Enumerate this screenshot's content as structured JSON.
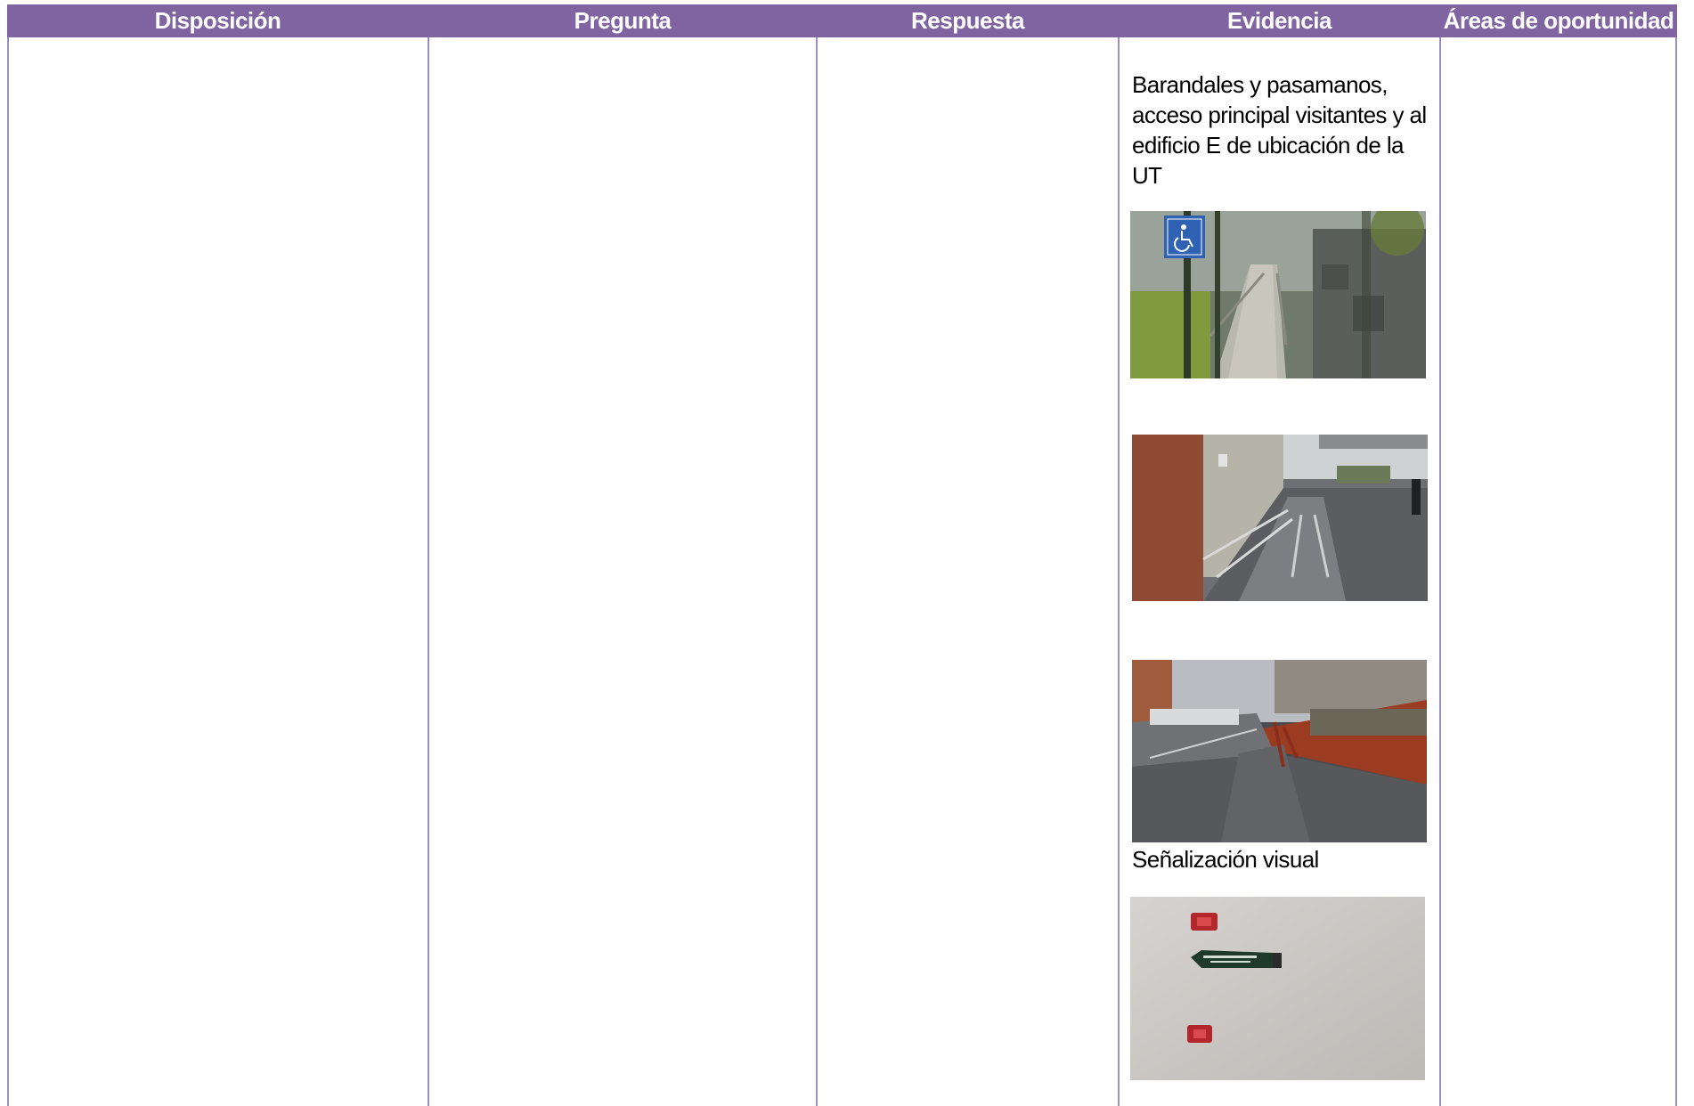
{
  "table": {
    "headers": [
      "Disposición",
      "Pregunta",
      "Respuesta",
      "Evidencia",
      "Áreas de oportunidad"
    ],
    "header_color": "#8064a2",
    "border_color": "#9b8fc4"
  },
  "evidence": {
    "text_1": "Barandales y pasamanos, acceso principal visitantes y al edificio E de ubicación de la UT",
    "text_2": "Señalización visual"
  }
}
